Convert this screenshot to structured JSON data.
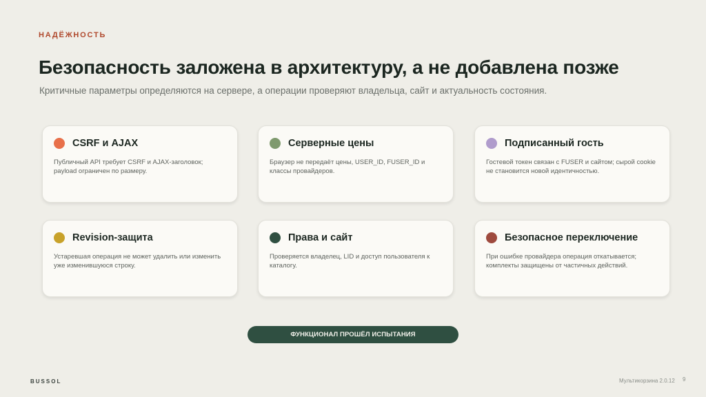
{
  "header": {
    "eyebrow": "НАДЁЖНОСТЬ",
    "title": "Безопасность заложена в архитектуру, а не добавлена позже",
    "subtitle": "Критичные параметры определяются на сервере, а операции проверяют владельца, сайт и актуальность состояния."
  },
  "cards": [
    {
      "title": "CSRF и AJAX",
      "text": "Публичный API требует CSRF и AJAX-заголовок; payload ограничен по размеру.",
      "color": "#e8704a"
    },
    {
      "title": "Серверные цены",
      "text": "Браузер не передаёт цены, USER_ID, FUSER_ID и классы провайдеров.",
      "color": "#7f9a6e"
    },
    {
      "title": "Подписанный гость",
      "text": "Гостевой токен связан с FUSER и сайтом; сырой cookie не становится новой идентичностью.",
      "color": "#b09ccc"
    },
    {
      "title": "Revision-защита",
      "text": "Устаревшая операция не может удалить или изменить уже изменившуюся строку.",
      "color": "#c8a22a"
    },
    {
      "title": "Права и сайт",
      "text": "Проверяется владелец, LID и доступ пользователя к каталогу.",
      "color": "#2f4f41"
    },
    {
      "title": "Безопасное переключение",
      "text": "При ошибке провайдера операция откатывается; комплекты защищены от частичных действий.",
      "color": "#9e4a3e"
    }
  ],
  "cta": {
    "label": "ФУНКЦИОНАЛ ПРОШЁЛ ИСПЫТАНИЯ"
  },
  "footer": {
    "brand": "BUSSOL",
    "version": "Мультикорзина 2.0.12",
    "page": "9"
  }
}
